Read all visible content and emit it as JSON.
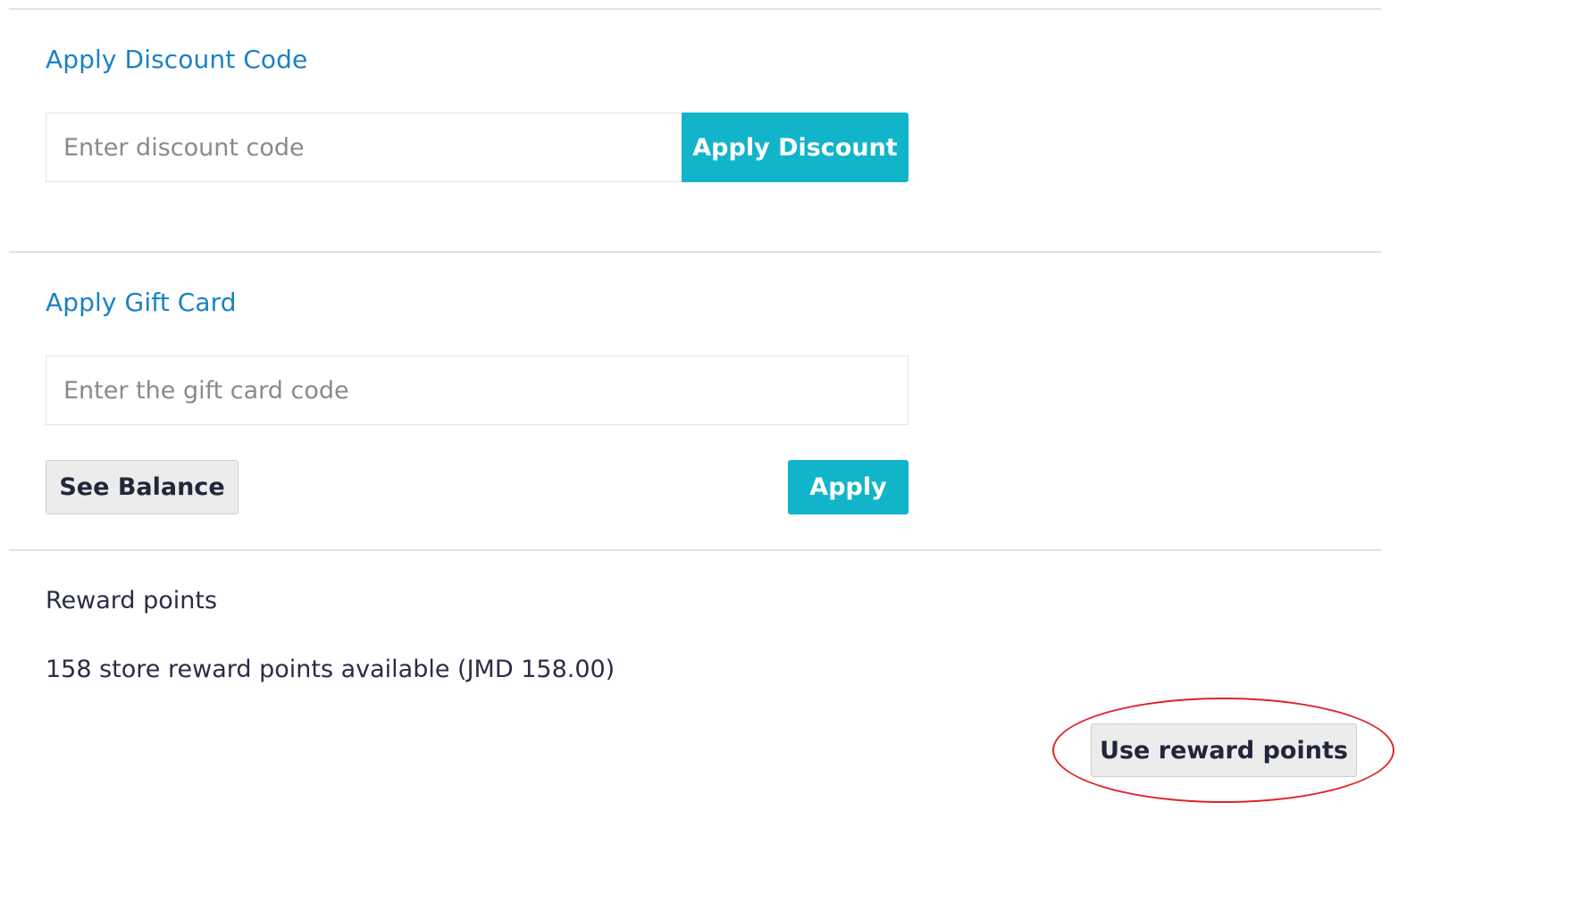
{
  "discount": {
    "title": "Apply Discount Code",
    "input_placeholder": "Enter discount code",
    "input_value": "",
    "button_label": "Apply Discount"
  },
  "gift_card": {
    "title": "Apply Gift Card",
    "input_placeholder": "Enter the gift card code",
    "input_value": "",
    "see_balance_label": "See Balance",
    "apply_label": "Apply"
  },
  "rewards": {
    "title": "Reward points",
    "available_text": "158 store reward points available (JMD 158.00)",
    "button_label": "Use reward points"
  },
  "colors": {
    "accent": "#12b4c9",
    "heading_link": "#1a82c4",
    "annotation_ring": "#e0242a"
  }
}
